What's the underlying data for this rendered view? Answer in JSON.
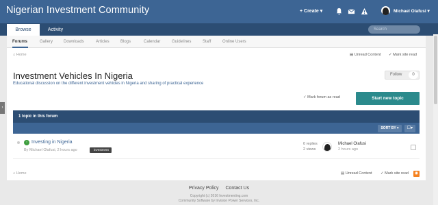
{
  "header": {
    "site_title": "Nigerian Investment Community",
    "create_label": "+ Create ▾",
    "user_name": "Michael Olafusi ▾"
  },
  "nav": {
    "tabs": [
      {
        "label": "Browse"
      },
      {
        "label": "Activity"
      }
    ],
    "search_placeholder": "Search"
  },
  "subnav": {
    "items": [
      "Forums",
      "Gallery",
      "Downloads",
      "Articles",
      "Blogs",
      "Calendar",
      "Guidelines",
      "Staff",
      "Online Users"
    ]
  },
  "breadcrumb": {
    "home": "Home",
    "unread": "Unread Content",
    "mark_site_read": "Mark site read"
  },
  "forum": {
    "title": "Investment Vehicles In Nigeria",
    "description": "Educational discussion on the different investment vehicles in Nigeria and sharing of practical experience",
    "follow_label": "Follow",
    "follow_count": "0",
    "mark_forum_read": "Mark forum as read",
    "new_topic": "Start new topic",
    "topic_count_label": "1 topic in this forum",
    "sort_label": "SORT BY ▾",
    "view_label": "☐▾"
  },
  "topics": [
    {
      "title": "Investing in Nigeria",
      "meta": "By Michael Olafusi, 2 hours ago",
      "tag": "investment",
      "replies": "0 replies",
      "views": "2 views",
      "last_poster": "Michael Olafusi",
      "last_time": "2 hours ago"
    }
  ],
  "footer": {
    "privacy": "Privacy Policy",
    "contact": "Contact Us",
    "copyright": "Copyright (c) 2016 Investmenting.com",
    "software": "Community Software by Invision Power Services, Inc."
  },
  "colors": {
    "header": "#3d6594",
    "navbar": "#2c4d73",
    "primary_button": "#2b8a8c"
  },
  "icons": [
    "bell-icon",
    "envelope-icon",
    "warning-icon",
    "home-icon",
    "check-icon",
    "rss-icon"
  ]
}
